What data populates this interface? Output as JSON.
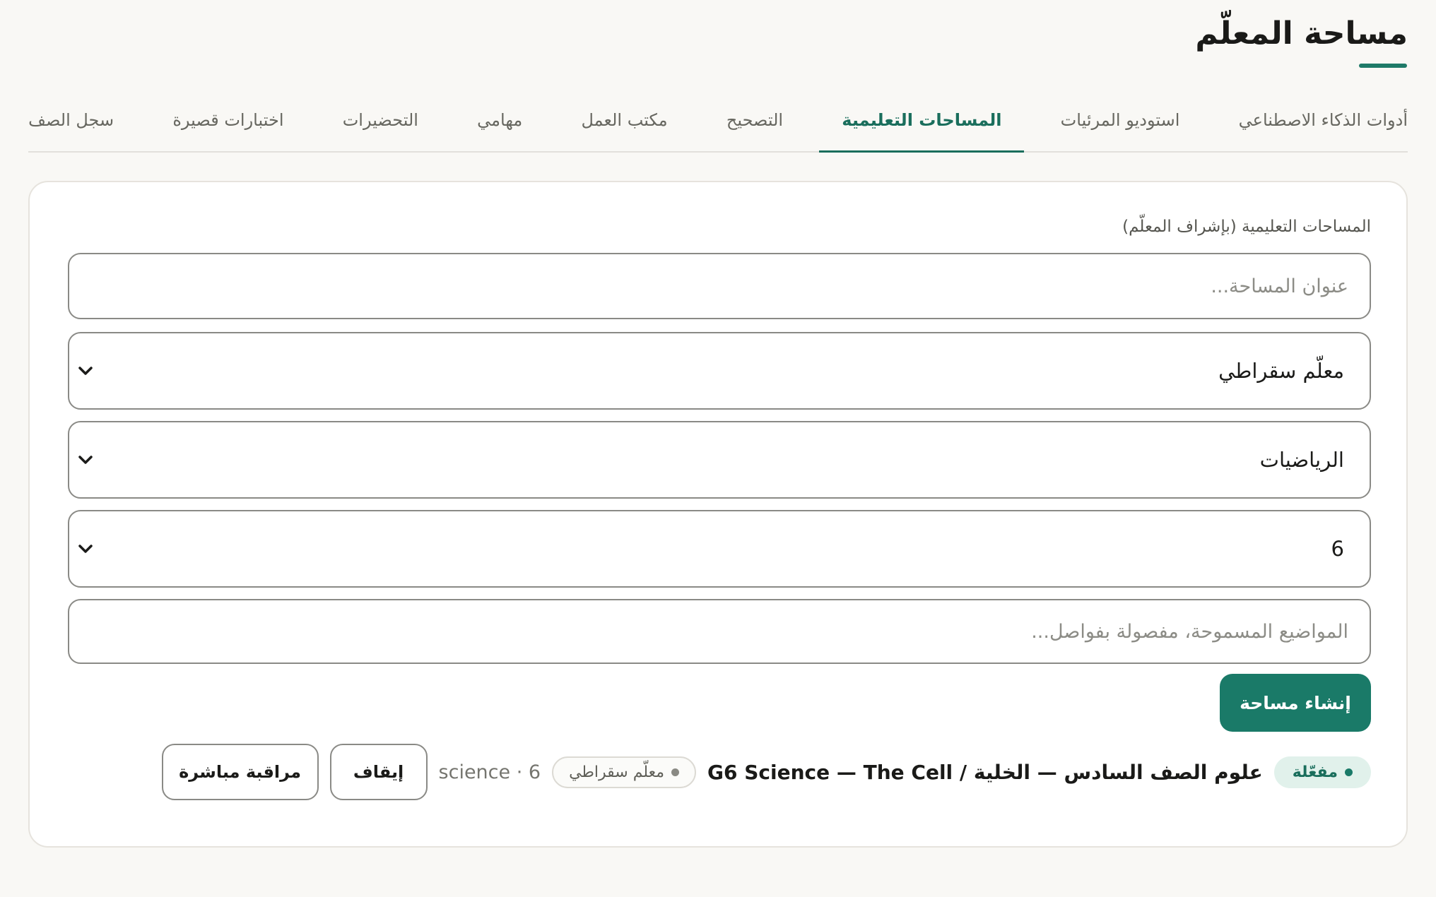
{
  "page": {
    "title": "مساحة المعلّم"
  },
  "tabs": [
    {
      "label": "أدوات الذكاء الاصطناعي",
      "active": false
    },
    {
      "label": "استوديو المرئيات",
      "active": false
    },
    {
      "label": "المساحات التعليمية",
      "active": true
    },
    {
      "label": "التصحيح",
      "active": false
    },
    {
      "label": "مكتب العمل",
      "active": false
    },
    {
      "label": "مهامي",
      "active": false
    },
    {
      "label": "التحضيرات",
      "active": false
    },
    {
      "label": "اختبارات قصيرة",
      "active": false
    },
    {
      "label": "سجل الصف",
      "active": false
    }
  ],
  "form": {
    "section_label": "المساحات التعليمية (بإشراف المعلّم)",
    "title_placeholder": "عنوان المساحة...",
    "title_value": "",
    "tutor_select": "معلّم سقراطي",
    "subject_select": "الرياضيات",
    "grade_select": "6",
    "topics_placeholder": "المواضيع المسموحة، مفصولة بفواصل...",
    "topics_value": "",
    "create_label": "إنشاء مساحة"
  },
  "spaces": [
    {
      "status": "مفعّلة",
      "name": "علوم الصف السادس — الخلية / G6 Science — The Cell",
      "tutor": "معلّم سقراطي",
      "meta": "science · 6",
      "stop_label": "إيقاف",
      "monitor_label": "مراقبة مباشرة"
    }
  ],
  "colors": {
    "accent": "#1a7a68",
    "background": "#f9f8f5",
    "active_badge_bg": "#e1f1eb"
  },
  "icons": {
    "select": "chevron-down-icon",
    "status": "dot-icon"
  }
}
